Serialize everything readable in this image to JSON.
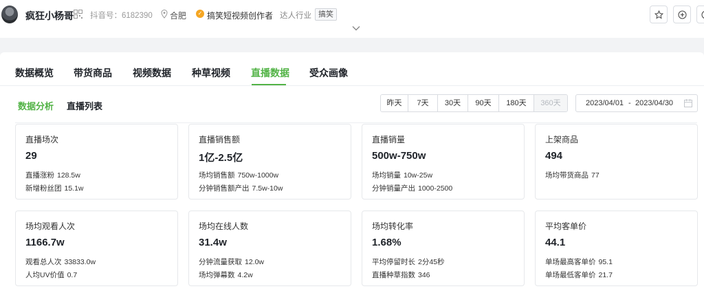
{
  "profile": {
    "name": "疯狂小杨哥",
    "account": "抖音号：6182390",
    "location": "合肥",
    "badge": "搞笑短视频创作者",
    "industry_label": "达人行业",
    "industry_tag": "搞笑"
  },
  "tabs": [
    "数据概览",
    "带货商品",
    "视频数据",
    "种草视频",
    "直播数据",
    "受众画像"
  ],
  "active_tab": "直播数据",
  "subtabs": [
    "数据分析",
    "直播列表"
  ],
  "time_ranges": [
    "昨天",
    "7天",
    "30天",
    "90天",
    "180天",
    "360天"
  ],
  "date_range": {
    "start": "2023/04/01",
    "separator": "-",
    "end": "2023/04/30"
  },
  "cards": [
    {
      "title": "直播场次",
      "value": "29",
      "subs": [
        {
          "label": "直播涨粉",
          "value": "128.5w"
        },
        {
          "label": "新增粉丝团",
          "value": "15.1w"
        }
      ]
    },
    {
      "title": "直播销售额",
      "value": "1亿-2.5亿",
      "subs": [
        {
          "label": "场均销售额",
          "value": "750w-1000w"
        },
        {
          "label": "分钟销售额产出",
          "value": "7.5w-10w"
        }
      ]
    },
    {
      "title": "直播销量",
      "value": "500w-750w",
      "subs": [
        {
          "label": "场均销量",
          "value": "10w-25w"
        },
        {
          "label": "分钟销量产出",
          "value": "1000-2500"
        }
      ]
    },
    {
      "title": "上架商品",
      "value": "494",
      "subs": [
        {
          "label": "场均带货商品",
          "value": "77"
        }
      ]
    },
    {
      "title": "场均观看人次",
      "value": "1166.7w",
      "subs": [
        {
          "label": "观看总人次",
          "value": "33833.0w"
        },
        {
          "label": "人均UV价值",
          "value": "0.7"
        }
      ]
    },
    {
      "title": "场均在线人数",
      "value": "31.4w",
      "subs": [
        {
          "label": "分钟流量获取",
          "value": "12.0w"
        },
        {
          "label": "场均弹幕数",
          "value": "4.2w"
        }
      ]
    },
    {
      "title": "场均转化率",
      "value": "1.68%",
      "subs": [
        {
          "label": "平均停留时长",
          "value": "2分45秒"
        },
        {
          "label": "直播种草指数",
          "value": "346"
        }
      ]
    },
    {
      "title": "平均客单价",
      "value": "44.1",
      "subs": [
        {
          "label": "单场最高客单价",
          "value": "95.1"
        },
        {
          "label": "单场最低客单价",
          "value": "21.7"
        }
      ]
    }
  ],
  "colors": {
    "accent": "#52b346",
    "badge": "#f5a623"
  }
}
